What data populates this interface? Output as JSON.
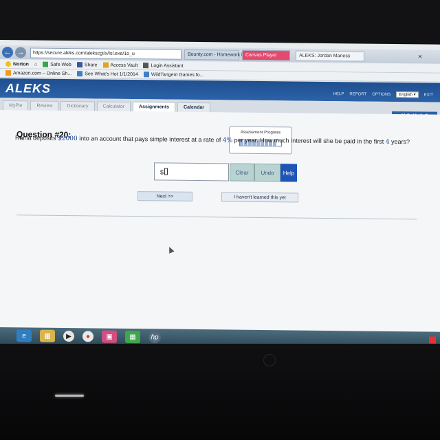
{
  "browser": {
    "url": "https://secure.aleks.com/alekscgi/x/Isl.exe/1o_u",
    "tabs": [
      "Bounty.com - Homework help...",
      "Canvas Player",
      "ALEKS: Jordan Maness"
    ],
    "close_symbol": "×",
    "toolbar": {
      "norton": "Norton",
      "safe_web": "Safe Web",
      "share": "Share",
      "access_vault": "Access Vault",
      "login_assistant": "Login Assistant"
    },
    "bookmarks": [
      "Amazon.com – Online Sh...",
      "See What's Hot 1/1/2014",
      "WildTangent Games fo..."
    ]
  },
  "aleks": {
    "logo": "ALEKS",
    "header_links": [
      "HELP",
      "REPORT",
      "OPTIONS"
    ],
    "language": "English",
    "exit": "EXIT",
    "tabs": [
      "MyPie",
      "Review",
      "Dictionary",
      "Calculator",
      "Assignments",
      "Calendar"
    ],
    "active_tab": "Assignments",
    "course": "M.S. Math 3"
  },
  "question": {
    "title": "Question #20:",
    "progress_label": "Assessment Progress",
    "progress_fraction": 0.9,
    "text_1": "Raina deposits",
    "amount": "$2000",
    "text_2": "into an account that pays simple interest at a rate of",
    "rate": "4%",
    "text_3": "per year. How much interest will she be paid in the first",
    "years": "4",
    "text_4": "years?",
    "answer_prefix": "$",
    "answer_value": ""
  },
  "buttons": {
    "clear": "Clear",
    "undo": "Undo",
    "help": "Help",
    "next": "Next >>",
    "havent_learned": "I haven't learned this yet"
  },
  "taskbar": {
    "hp_logo": "hp",
    "icons": [
      "internet-explorer-icon",
      "folder-icon",
      "media-player-icon",
      "chrome-icon",
      "remote-icon",
      "windows-icon",
      "hp-icon"
    ]
  },
  "colors": {
    "aleks_blue": "#2b62a8",
    "help_blue": "#1e56b5",
    "tool_teal": "#b9d3d3",
    "number_blue": "#1c3f8f"
  }
}
